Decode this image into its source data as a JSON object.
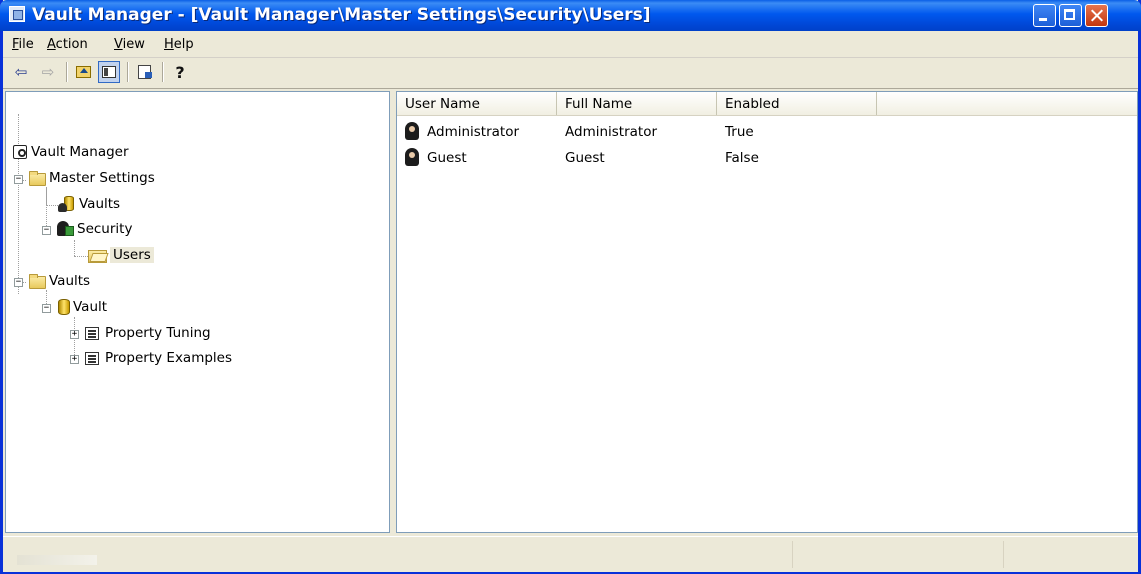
{
  "window": {
    "title": "Vault Manager - [Vault Manager\\Master Settings\\Security\\Users]"
  },
  "menu": [
    {
      "label_pre": "",
      "label_u": "F",
      "label_post": "ile"
    },
    {
      "label_pre": "",
      "label_u": "A",
      "label_post": "ction"
    },
    {
      "label_pre": "",
      "label_u": "V",
      "label_post": "iew"
    },
    {
      "label_pre": "",
      "label_u": "H",
      "label_post": "elp"
    }
  ],
  "toolbar": {
    "back_glyph": "⇦",
    "forward_glyph": "⇨",
    "help_glyph": "?",
    "icons": [
      "back-arrow-icon",
      "forward-arrow-icon",
      "up-one-level-icon",
      "show-hide-console-tree-icon",
      "export-list-icon",
      "help-icon"
    ]
  },
  "tree": {
    "items": [
      {
        "label": "Vault Manager",
        "icon": "vault-manager-icon"
      },
      {
        "label": "Master Settings",
        "icon": "folder-icon"
      },
      {
        "label": "Vaults",
        "icon": "vaults-icon"
      },
      {
        "label": "Security",
        "icon": "security-icon"
      },
      {
        "label": "Users",
        "icon": "users-folder-icon",
        "selected": true
      },
      {
        "label": "Vaults",
        "icon": "folder-icon"
      },
      {
        "label": "Vault",
        "icon": "vault-icon"
      },
      {
        "label": "Property Tuning",
        "icon": "properties-icon"
      },
      {
        "label": "Property Examples",
        "icon": "properties-icon"
      }
    ],
    "expand_minus": "−",
    "expand_plus": "+"
  },
  "list": {
    "columns": [
      "User Name",
      "Full Name",
      "Enabled"
    ],
    "rows": [
      {
        "user_name": "Administrator",
        "full_name": "Administrator",
        "enabled": "True"
      },
      {
        "user_name": "Guest",
        "full_name": "Guest",
        "enabled": "False"
      }
    ]
  },
  "status": {
    "segments": [
      "",
      "",
      ""
    ]
  }
}
